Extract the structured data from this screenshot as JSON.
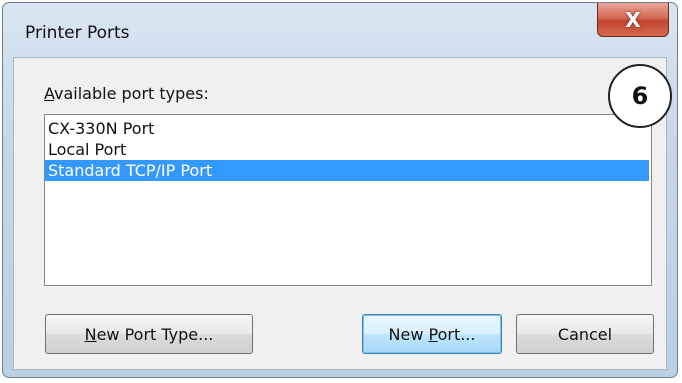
{
  "window": {
    "title": "Printer Ports",
    "close_glyph": "X"
  },
  "dialog": {
    "label_access_key": "A",
    "label_rest": "vailable port types:",
    "ports": [
      {
        "label": "CX-330N Port",
        "selected": false
      },
      {
        "label": "Local Port",
        "selected": false
      },
      {
        "label": "Standard TCP/IP Port",
        "selected": true
      }
    ]
  },
  "buttons": {
    "new_port_type": {
      "access_key": "N",
      "rest": "ew Port Type..."
    },
    "new_port": {
      "prefix": "New ",
      "access_key": "P",
      "rest": "ort..."
    },
    "cancel": "Cancel"
  },
  "annotation": {
    "step_number": "6"
  },
  "colors": {
    "selection": "#3399ff",
    "close_button": "#c2442e",
    "window_frame": "#c6d6e6"
  }
}
